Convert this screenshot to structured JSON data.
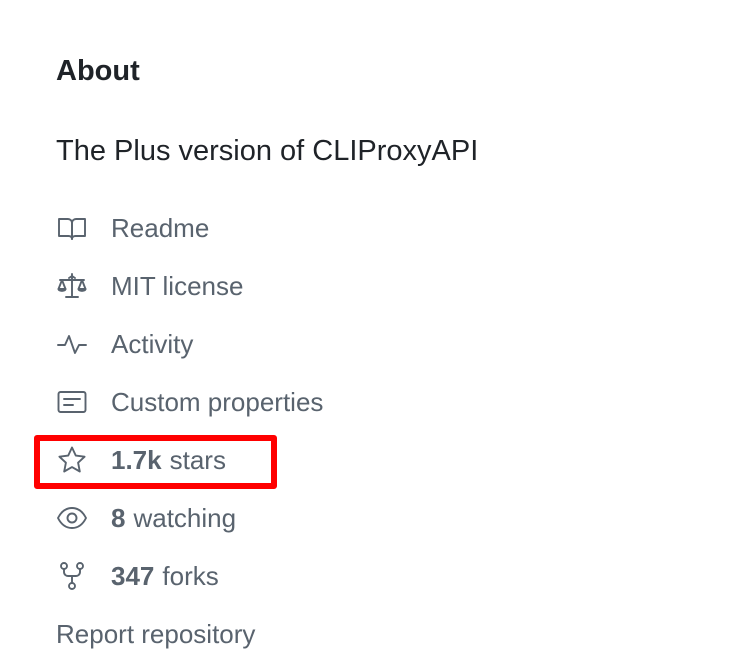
{
  "about": {
    "heading": "About",
    "description": "The Plus version of CLIProxyAPI"
  },
  "meta": {
    "readme": {
      "label": "Readme",
      "icon": "book-icon"
    },
    "license": {
      "label": "MIT license",
      "icon": "law-icon"
    },
    "activity": {
      "label": "Activity",
      "icon": "pulse-icon"
    },
    "custom_properties": {
      "label": "Custom properties",
      "icon": "note-icon"
    },
    "stars": {
      "count": "1.7k",
      "label": "stars",
      "icon": "star-icon"
    },
    "watching": {
      "count": "8",
      "label": "watching",
      "icon": "eye-icon"
    },
    "forks": {
      "count": "347",
      "label": "forks",
      "icon": "repo-forked-icon"
    }
  },
  "report_label": "Report repository",
  "colors": {
    "text_primary": "#1f2328",
    "text_muted": "#59636e",
    "highlight": "#ff0000"
  }
}
